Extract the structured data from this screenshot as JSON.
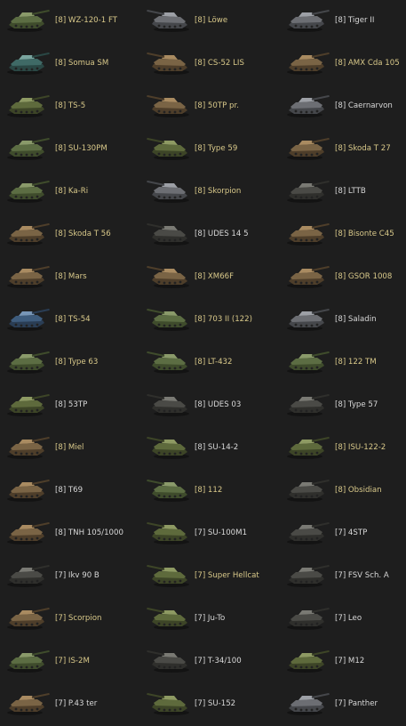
{
  "colors": {
    "background": "#1e1e1e",
    "regular_text": "#d8d8d8",
    "premium_text": "#d9c98a"
  },
  "tanks": [
    {
      "label": "[8] WZ-120-1 FT",
      "premium": true,
      "icon": "tank-green-icon"
    },
    {
      "label": "[8] Löwe",
      "premium": true,
      "icon": "tank-grey-icon"
    },
    {
      "label": "[8] Tiger II",
      "premium": false,
      "icon": "tank-grey-icon"
    },
    {
      "label": "[8] Somua SM",
      "premium": true,
      "icon": "tank-teal-icon"
    },
    {
      "label": "[8] CS-52 LIS",
      "premium": true,
      "icon": "tank-camo-icon"
    },
    {
      "label": "[8] AMX Cda 105",
      "premium": true,
      "icon": "tank-camo-icon"
    },
    {
      "label": "[8] TS-5",
      "premium": true,
      "icon": "tank-olive-icon"
    },
    {
      "label": "[8] 50TP pr.",
      "premium": true,
      "icon": "tank-camo-icon"
    },
    {
      "label": "[8] Caernarvon",
      "premium": false,
      "icon": "tank-grey-icon"
    },
    {
      "label": "[8] SU-130PM",
      "premium": true,
      "icon": "tank-green-icon"
    },
    {
      "label": "[8] Type 59",
      "premium": true,
      "icon": "tank-olive-icon"
    },
    {
      "label": "[8] Skoda T 27",
      "premium": true,
      "icon": "tank-camo-icon"
    },
    {
      "label": "[8] Ka-Ri",
      "premium": true,
      "icon": "tank-green-icon"
    },
    {
      "label": "[8] Skorpion",
      "premium": true,
      "icon": "tank-grey-icon"
    },
    {
      "label": "[8] LTTB",
      "premium": false,
      "icon": "tank-dark-icon"
    },
    {
      "label": "[8] Skoda T 56",
      "premium": true,
      "icon": "tank-camo-icon"
    },
    {
      "label": "[8] UDES 14 5",
      "premium": false,
      "icon": "tank-dark-icon"
    },
    {
      "label": "[8] Bisonte C45",
      "premium": true,
      "icon": "tank-camo-icon"
    },
    {
      "label": "[8] Mars",
      "premium": true,
      "icon": "tank-camo-icon"
    },
    {
      "label": "[8] XM66F",
      "premium": true,
      "icon": "tank-camo-icon"
    },
    {
      "label": "[8] GSOR 1008",
      "premium": true,
      "icon": "tank-camo-icon"
    },
    {
      "label": "[8] TS-54",
      "premium": true,
      "icon": "tank-blue-icon"
    },
    {
      "label": "[8] 703 II (122)",
      "premium": true,
      "icon": "tank-green-icon"
    },
    {
      "label": "[8] Saladin",
      "premium": false,
      "icon": "tank-grey-icon"
    },
    {
      "label": "[8] Type 63",
      "premium": true,
      "icon": "tank-green-icon"
    },
    {
      "label": "[8] LT-432",
      "premium": true,
      "icon": "tank-green-icon"
    },
    {
      "label": "[8] 122 TM",
      "premium": true,
      "icon": "tank-green-icon"
    },
    {
      "label": "[8] 53TP",
      "premium": false,
      "icon": "tank-olive-icon"
    },
    {
      "label": "[8] UDES 03",
      "premium": false,
      "icon": "tank-dark-icon"
    },
    {
      "label": "[8] Type 57",
      "premium": false,
      "icon": "tank-dark-icon"
    },
    {
      "label": "[8] Miel",
      "premium": true,
      "icon": "tank-camo-icon"
    },
    {
      "label": "[8] SU-14-2",
      "premium": false,
      "icon": "tank-olive-icon"
    },
    {
      "label": "[8] ISU-122-2",
      "premium": true,
      "icon": "tank-olive-icon"
    },
    {
      "label": "[8] T69",
      "premium": false,
      "icon": "tank-camo-icon"
    },
    {
      "label": "[8] 112",
      "premium": true,
      "icon": "tank-green-icon"
    },
    {
      "label": "[8] Obsidian",
      "premium": true,
      "icon": "tank-dark-icon"
    },
    {
      "label": "[8] TNH 105/1000",
      "premium": false,
      "icon": "tank-camo-icon"
    },
    {
      "label": "[7] SU-100M1",
      "premium": false,
      "icon": "tank-olive-icon"
    },
    {
      "label": "[7] 4STP",
      "premium": false,
      "icon": "tank-dark-icon"
    },
    {
      "label": "[7] Ikv 90 B",
      "premium": false,
      "icon": "tank-dark-icon"
    },
    {
      "label": "[7] Super Hellcat",
      "premium": true,
      "icon": "tank-olive-icon"
    },
    {
      "label": "[7] FSV Sch. A",
      "premium": false,
      "icon": "tank-dark-icon"
    },
    {
      "label": "[7] Scorpion",
      "premium": true,
      "icon": "tank-camo-icon"
    },
    {
      "label": "[7] Ju-To",
      "premium": false,
      "icon": "tank-olive-icon"
    },
    {
      "label": "[7] Leo",
      "premium": false,
      "icon": "tank-dark-icon"
    },
    {
      "label": "[7] IS-2M",
      "premium": true,
      "icon": "tank-green-icon"
    },
    {
      "label": "[7] T-34/100",
      "premium": false,
      "icon": "tank-dark-icon"
    },
    {
      "label": "[7] M12",
      "premium": false,
      "icon": "tank-olive-icon"
    },
    {
      "label": "[7] P.43 ter",
      "premium": false,
      "icon": "tank-camo-icon"
    },
    {
      "label": "[7] SU-152",
      "premium": false,
      "icon": "tank-olive-icon"
    },
    {
      "label": "[7] Panther",
      "premium": false,
      "icon": "tank-grey-icon"
    }
  ]
}
